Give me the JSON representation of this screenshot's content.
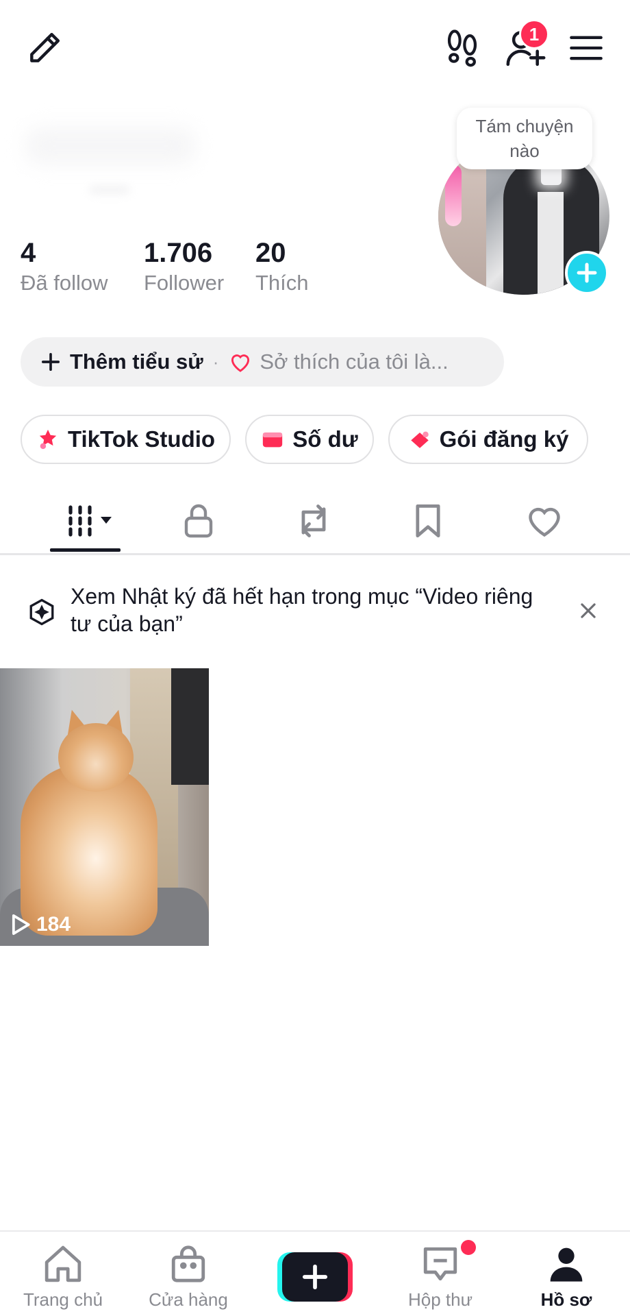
{
  "header": {
    "edit_icon": "pencil-icon",
    "footprints_icon": "footprints-icon",
    "add_friends_icon": "add-user-icon",
    "notification_count": "1",
    "menu_icon": "hamburger-menu-icon"
  },
  "profile": {
    "bubble_text_line1": "Tám chuyện",
    "bubble_text_line2": "nào",
    "stats": [
      {
        "value": "4",
        "label": "Đã follow"
      },
      {
        "value": "1.706",
        "label": "Follower"
      },
      {
        "value": "20",
        "label": "Thích"
      }
    ],
    "bio": {
      "add_label": "Thêm tiểu sử",
      "separator": "·",
      "hint": "Sở thích của tôi là..."
    }
  },
  "quick_actions": [
    {
      "label": "TikTok Studio",
      "icon": "studio-icon"
    },
    {
      "label": "Số dư",
      "icon": "wallet-icon"
    },
    {
      "label": "Gói đăng ký",
      "icon": "subscription-icon"
    }
  ],
  "tabs": [
    {
      "name": "videos",
      "icon": "grid-icon",
      "active": true
    },
    {
      "name": "private",
      "icon": "lock-icon"
    },
    {
      "name": "reposts",
      "icon": "repost-icon"
    },
    {
      "name": "favorites",
      "icon": "bookmark-icon"
    },
    {
      "name": "liked",
      "icon": "heart-icon"
    }
  ],
  "notice": {
    "text": "Xem Nhật ký đã hết hạn trong mục “Video riêng tư của bạn”"
  },
  "videos": [
    {
      "views": "184"
    }
  ],
  "bottom_nav": [
    {
      "label": "Trang chủ",
      "icon": "home-icon"
    },
    {
      "label": "Cửa hàng",
      "icon": "shop-bag-icon"
    },
    {
      "label": "",
      "icon": "create-plus-icon"
    },
    {
      "label": "Hộp thư",
      "icon": "inbox-icon"
    },
    {
      "label": "Hồ sơ",
      "icon": "profile-icon",
      "active": true
    }
  ],
  "colors": {
    "accent_pink": "#fe2c55",
    "accent_cyan": "#25f4ee",
    "avatar_plus": "#20d5ec",
    "text_primary": "#161823",
    "text_secondary": "#8a8b91"
  }
}
